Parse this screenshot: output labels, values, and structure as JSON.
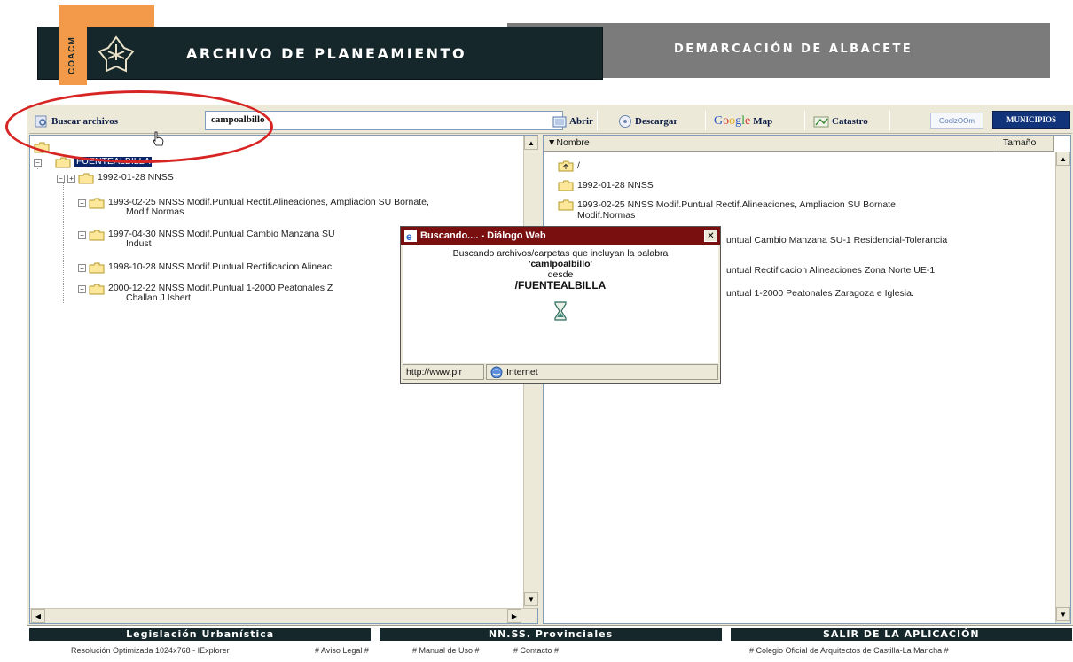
{
  "header": {
    "coach_text": "COACM",
    "app_title": "ARCHIVO DE PLANEAMIENTO",
    "demarcation": "DEMARCACIÓN DE ALBACETE"
  },
  "toolbar": {
    "search_button": "Buscar archivos",
    "search_value": "campoalbillo",
    "open": "Abrir",
    "download": "Descargar",
    "google_map": "Map",
    "catastro": "Catastro",
    "zoom": "GoolzOOm",
    "municipios": "MUNICIPIOS"
  },
  "tree": {
    "root_label": "FUENTEALBILLA",
    "items": [
      "1992-01-28  NNSS",
      "1993-02-25  NNSS Modif.Puntual Rectif.Alineaciones, Ampliacion SU Bornate,",
      "Modif.Normas",
      "1997-04-30  NNSS Modif.Puntual Cambio Manzana SU",
      "Indust",
      "1998-10-28  NNSS Modif.Puntual Rectificacion Alineac",
      "2000-12-22  NNSS Modif.Puntual 1-2000 Peatonales Z",
      "Challan J.Isbert"
    ]
  },
  "files": {
    "col_name": "Nombre",
    "col_size": "Tamaño",
    "rows": [
      "/",
      "1992-01-28  NNSS",
      "1993-02-25  NNSS Modif.Puntual Rectif.Alineaciones, Ampliacion SU Bornate,",
      "Modif.Normas",
      "untual Cambio Manzana SU-1 Residencial-Tolerancia",
      "untual Rectificacion Alineaciones Zona Norte UE-1",
      "untual 1-2000 Peatonales Zaragoza e Iglesia."
    ]
  },
  "dialog": {
    "title": "Buscando.... - Diálogo Web",
    "line1": "Buscando archivos/carpetas que incluyan la palabra",
    "term": "'camlpoalbillo'",
    "line3": "desde",
    "path": "/FUENTEALBILLA",
    "status_url": "http://www.plr",
    "status_zone": "Internet"
  },
  "footer": {
    "nav": [
      "Legislación  Urbanística",
      "NN.SS.  Provinciales",
      "SALIR  DE  LA  APLICACIÓN"
    ],
    "resolution": "Resolución Optimizada 1024x768 - IExplorer",
    "links": [
      "# Aviso Legal #",
      "# Manual de Uso #",
      "# Contacto #",
      "# Colegio Oficial de Arquitectos de Castilla-La Mancha #"
    ]
  },
  "colors": {
    "header_dark": "#15272a",
    "accent_orange": "#f39a4a",
    "dialog_title": "#7a0f0f",
    "annotation_red": "#d72524",
    "selection": "#0a246a"
  }
}
